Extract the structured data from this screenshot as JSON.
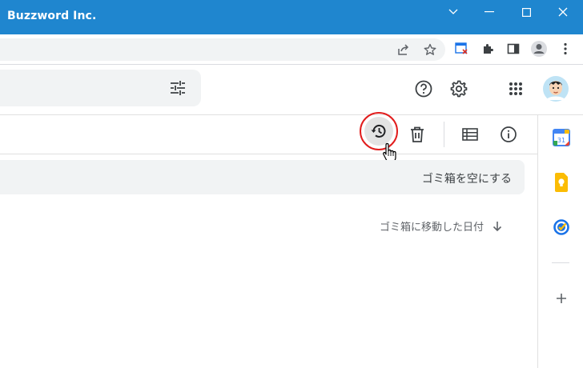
{
  "window": {
    "title": "Buzzword Inc."
  },
  "actions": {
    "restore_tooltip": "",
    "delete_tooltip": ""
  },
  "trash": {
    "empty_label": "ゴミ箱を空にする",
    "sort_label": "ゴミ箱に移動した日付"
  },
  "side_panel": {
    "calendar_day": "31",
    "items": [
      "calendar-icon",
      "keep-icon",
      "tasks-icon",
      "add-icon"
    ]
  },
  "colors": {
    "titlebar": "#1f86cf",
    "highlight_ring": "#e11d1d",
    "surface": "#f1f3f4"
  }
}
